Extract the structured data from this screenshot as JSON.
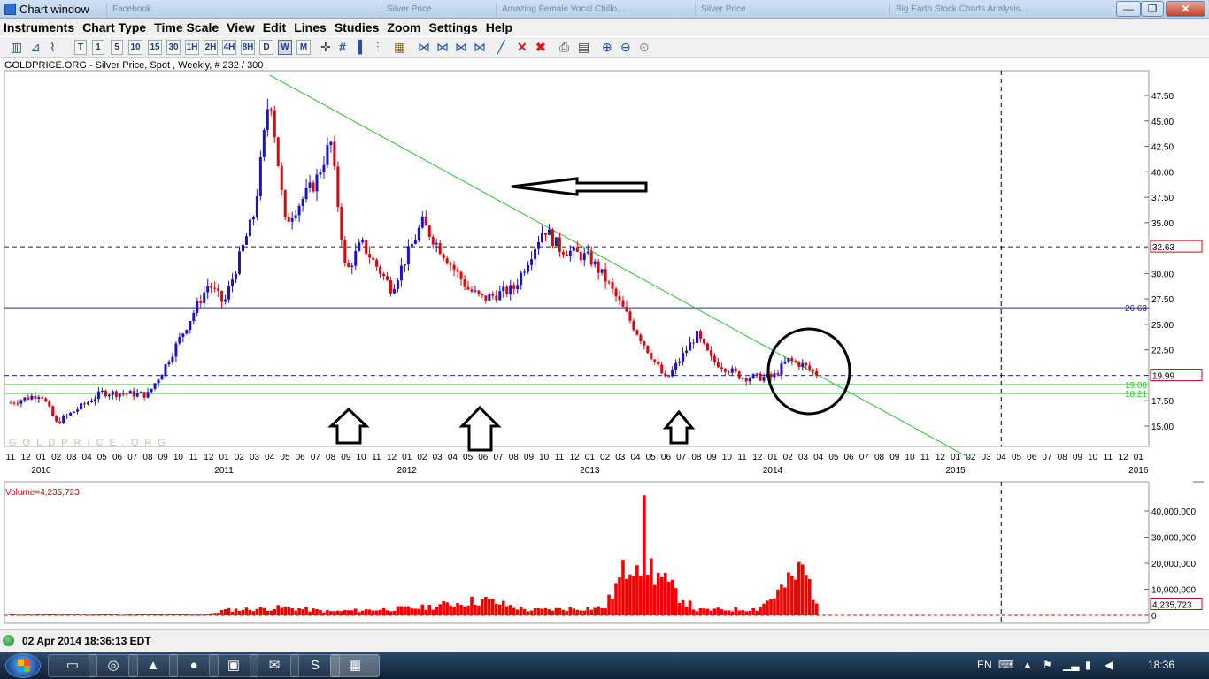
{
  "window": {
    "title": "Chart window",
    "background_tabs": [
      "Facebook",
      "Silver Price",
      "Amazing Female Vocal Chillo...",
      "Silver Price",
      "Big Earth Stock Charts Analysis..."
    ],
    "controls": [
      "—",
      "❐",
      "✕"
    ]
  },
  "menu": [
    "Instruments",
    "Chart Type",
    "Time Scale",
    "View",
    "Edit",
    "Lines",
    "Studies",
    "Zoom",
    "Settings",
    "Help"
  ],
  "toolbar": {
    "timeframes": [
      "T",
      "1",
      "5",
      "10",
      "15",
      "30",
      "1H",
      "2H",
      "4H",
      "8H",
      "D",
      "W",
      "M"
    ],
    "selected_timeframe": "W",
    "tools": [
      "chart-type-icon",
      "line-icon",
      "grid-icon",
      "crosshair-icon",
      "hash-icon",
      "bar-chart-icon",
      "trendline-icon",
      "fibonacci-icon",
      "delete-icon",
      "delete-all-icon",
      "print-icon",
      "save-icon",
      "zoom-in-icon",
      "zoom-out-icon",
      "zoom-reset-icon"
    ]
  },
  "chart_header": "GOLDPRICE.ORG - Silver Price, Spot , Weekly, # 232 / 300",
  "watermark": "GOLDPRICE.ORG",
  "colors": {
    "up": "#1a13c8",
    "down": "#d4080f",
    "trend": "#2fbf2f",
    "support": "#25c925",
    "level": "#1c2a9c",
    "volume": "#f00000"
  },
  "chart_data": {
    "type": "candlestick",
    "title": "GOLDPRICE.ORG - Silver Price, Spot , Weekly, # 232 / 300",
    "y_axis": {
      "ticks": [
        "15.00",
        "17.50",
        "20.00",
        "22.50",
        "25.00",
        "27.50",
        "30.00",
        "32.50",
        "35.00",
        "37.50",
        "40.00",
        "42.50",
        "45.00",
        "47.50"
      ],
      "range": [
        12.9,
        50.8
      ]
    },
    "x_axis": {
      "month_ticks": [
        "11",
        "12",
        "01",
        "02",
        "03",
        "04",
        "05",
        "06",
        "07",
        "08",
        "09",
        "10",
        "11",
        "12",
        "01",
        "02",
        "03",
        "04",
        "05",
        "06",
        "07",
        "08",
        "09",
        "10",
        "11",
        "12",
        "01",
        "02",
        "03",
        "04",
        "05",
        "06",
        "07",
        "08",
        "09",
        "10",
        "11",
        "12",
        "01",
        "02",
        "03",
        "04",
        "05",
        "06",
        "07",
        "08",
        "09",
        "10",
        "11",
        "12",
        "01",
        "02",
        "03",
        "04",
        "05",
        "06",
        "07",
        "08",
        "09",
        "10",
        "11",
        "12",
        "01",
        "02",
        "03",
        "04",
        "05",
        "06",
        "07",
        "08",
        "09",
        "10",
        "11",
        "12",
        "01"
      ],
      "year_labels": [
        "2010",
        "2011",
        "2012",
        "2013",
        "2014",
        "2015",
        "2016"
      ]
    },
    "anchors": [
      [
        "2009-11",
        17.3
      ],
      [
        "2010-01",
        18.2
      ],
      [
        "2010-02",
        15.3
      ],
      [
        "2010-05",
        18.3
      ],
      [
        "2010-08",
        18.1
      ],
      [
        "2010-09",
        20.5
      ],
      [
        "2010-12",
        29.0
      ],
      [
        "2011-01",
        27.0
      ],
      [
        "2011-03",
        36.0
      ],
      [
        "2011-04",
        48.0
      ],
      [
        "2011-05",
        35.0
      ],
      [
        "2011-07",
        39.0
      ],
      [
        "2011-08",
        43.0
      ],
      [
        "2011-09",
        30.0
      ],
      [
        "2011-10",
        33.0
      ],
      [
        "2011-12",
        28.5
      ],
      [
        "2012-02",
        35.0
      ],
      [
        "2012-05",
        28.5
      ],
      [
        "2012-06",
        27.5
      ],
      [
        "2012-08",
        28.5
      ],
      [
        "2012-10",
        34.5
      ],
      [
        "2012-11",
        32.5
      ],
      [
        "2013-01",
        31.5
      ],
      [
        "2013-02",
        29.5
      ],
      [
        "2013-04",
        24.5
      ],
      [
        "2013-06",
        19.5
      ],
      [
        "2013-08",
        24.0
      ],
      [
        "2013-09",
        21.5
      ],
      [
        "2013-11",
        19.8
      ],
      [
        "2014-01",
        19.8
      ],
      [
        "2014-02",
        21.5
      ],
      [
        "2014-03",
        21.0
      ],
      [
        "2014-04",
        20.0
      ]
    ],
    "horizontal_lines": [
      {
        "label": "32.63",
        "value": 32.63,
        "style": "dashed"
      },
      {
        "label": "26.63",
        "value": 26.63,
        "style": "solid"
      },
      {
        "label": "19.99",
        "value": 19.99,
        "style": "dashed"
      },
      {
        "label": "19.08",
        "value": 19.08,
        "style": "solid"
      },
      {
        "label": "18.21",
        "value": 18.21,
        "style": "solid"
      }
    ],
    "trendline": {
      "from": [
        "2011-04",
        49.5
      ],
      "to": [
        "2015-02",
        11.8
      ]
    },
    "vertical_marker": "2015-04",
    "volume": {
      "label": "Volume=4,235,723",
      "last_value": "4,235,723",
      "ticks": [
        "0",
        "10,000,000",
        "20,000,000",
        "30,000,000",
        "40,000,000"
      ],
      "anchors": [
        [
          "2009-11",
          0.3
        ],
        [
          "2010-12",
          0.3
        ],
        [
          "2011-01",
          2.0
        ],
        [
          "2011-05",
          3.0
        ],
        [
          "2011-08",
          1.5
        ],
        [
          "2012-02",
          3.0
        ],
        [
          "2012-06",
          6.0
        ],
        [
          "2012-09",
          2.0
        ],
        [
          "2013-02",
          3.0
        ],
        [
          "2013-04",
          25.0
        ],
        [
          "2013-06",
          12.0
        ],
        [
          "2013-08",
          2.0
        ],
        [
          "2013-12",
          2.5
        ],
        [
          "2014-02",
          12.0
        ],
        [
          "2014-03",
          18.0
        ],
        [
          "2014-04",
          4.2
        ]
      ]
    }
  },
  "annotations": [
    "up-arrow",
    "up-arrow",
    "up-arrow",
    "left-arrow",
    "circle"
  ],
  "status": {
    "datetime": "02 Apr 2014 18:36:13 EDT"
  },
  "taskbar": {
    "language": "EN",
    "clock": "18:36"
  }
}
